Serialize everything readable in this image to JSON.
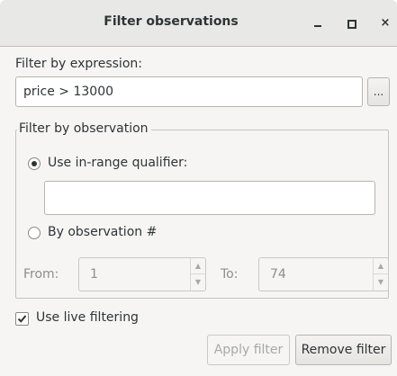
{
  "window": {
    "title": "Filter observations",
    "minimize_icon": "minimize-icon",
    "maximize_icon": "maximize-icon",
    "close_icon": "close-icon",
    "close_glyph": "×"
  },
  "expression": {
    "label": "Filter by expression:",
    "value": "price > 13000",
    "browse_label": "..."
  },
  "observation_group": {
    "title": "Filter by observation",
    "in_range": {
      "label": "Use in-range qualifier:",
      "selected": true,
      "value": ""
    },
    "by_number": {
      "label": "By observation #",
      "selected": false,
      "from_label": "From:",
      "from_value": "1",
      "to_label": "To:",
      "to_value": "74"
    }
  },
  "live_filtering": {
    "label": "Use live filtering",
    "checked": true
  },
  "buttons": {
    "apply": "Apply filter",
    "remove": "Remove filter"
  }
}
